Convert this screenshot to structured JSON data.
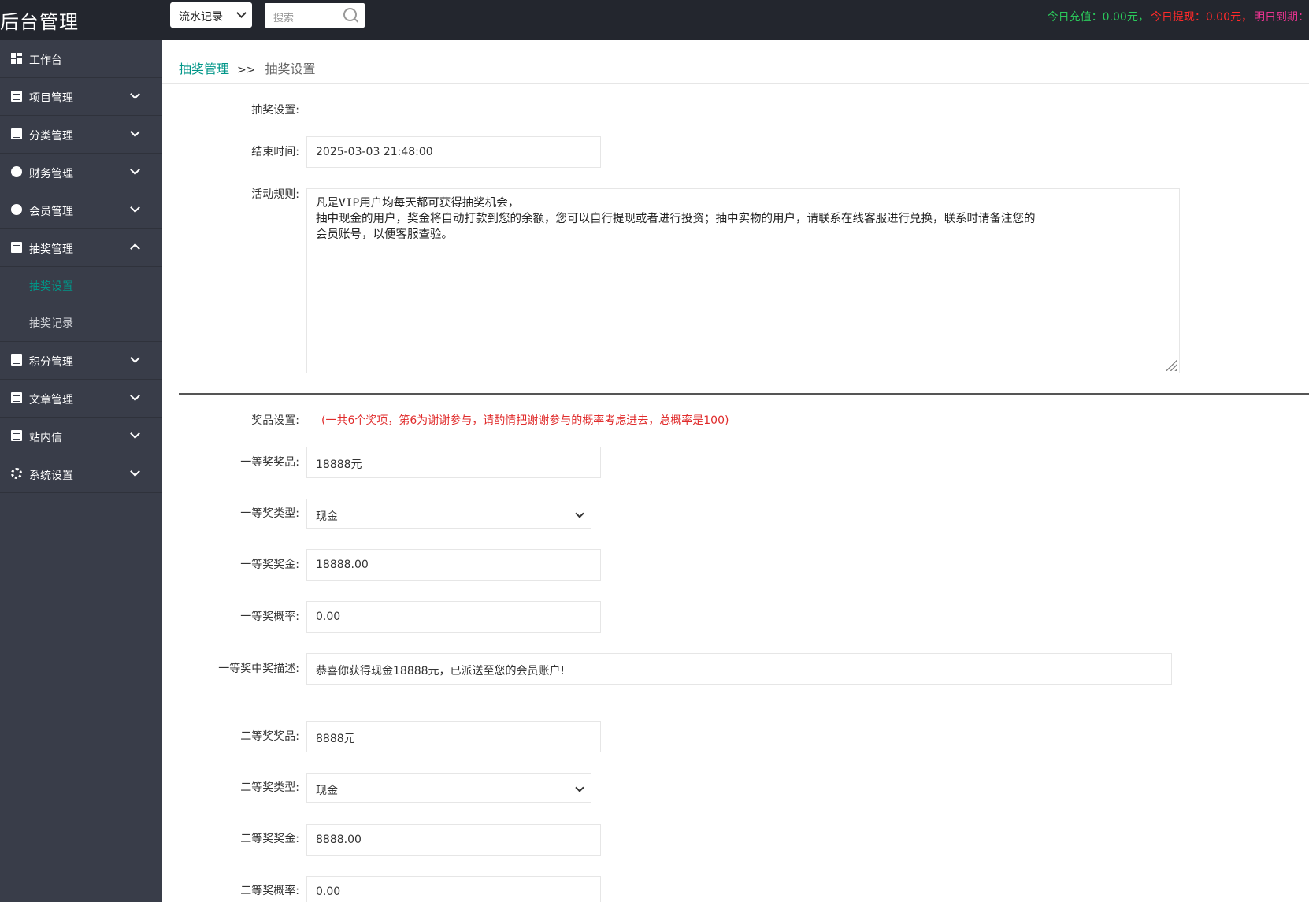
{
  "app": {
    "title": "后台管理"
  },
  "topbar": {
    "select_value": "流水记录",
    "search_placeholder": "搜索",
    "stats": [
      {
        "text": "今日充值：0.00元，",
        "color": "#2bc85b"
      },
      {
        "text": "今日提现：0.00元，",
        "color": "#ff2a2a"
      },
      {
        "text": "明日到期：",
        "color": "#e8338f"
      }
    ]
  },
  "sidebar": {
    "items": [
      {
        "label": "工作台",
        "icon": "dashboard-icon",
        "expandable": false
      },
      {
        "label": "项目管理",
        "icon": "document-icon",
        "expandable": true
      },
      {
        "label": "分类管理",
        "icon": "document-icon",
        "expandable": true
      },
      {
        "label": "财务管理",
        "icon": "yen-icon",
        "expandable": true
      },
      {
        "label": "会员管理",
        "icon": "vip-icon",
        "expandable": true
      },
      {
        "label": "抽奖管理",
        "icon": "document-icon",
        "expandable": true,
        "expanded": true,
        "children": [
          {
            "label": "抽奖设置",
            "active": true
          },
          {
            "label": "抽奖记录",
            "active": false
          }
        ]
      },
      {
        "label": "积分管理",
        "icon": "document-icon",
        "expandable": true
      },
      {
        "label": "文章管理",
        "icon": "document-icon",
        "expandable": true
      },
      {
        "label": "站内信",
        "icon": "document-icon",
        "expandable": true
      },
      {
        "label": "系统设置",
        "icon": "gear-icon",
        "expandable": true
      }
    ]
  },
  "breadcrumb": {
    "parent": "抽奖管理",
    "separator": ">>",
    "current": "抽奖设置"
  },
  "form": {
    "section1_label": "抽奖设置:",
    "end_time_label": "结束时间:",
    "end_time_value": "2025-03-03 21:48:00",
    "rules_label": "活动规则:",
    "rules_lines": [
      "凡是VIP用户均每天都可获得抽奖机会，",
      "抽中现金的用户，奖金将自动打款到您的余额，您可以自行提现或者进行投资；抽中实物的用户，请联系在线客服进行兑换，联系时请备注您的",
      "会员账号，以便客服查验。"
    ],
    "prize_section_label": "奖品设置:",
    "prize_note": "(一共6个奖项，第6为谢谢参与，请酌情把谢谢参与的概率考虑进去，总概率是100)",
    "first": {
      "prize_label": "一等奖奖品:",
      "prize_value": "18888元",
      "type_label": "一等奖类型:",
      "type_value": "现金",
      "amount_label": "一等奖奖金:",
      "amount_value": "18888.00",
      "rate_label": "一等奖概率:",
      "rate_value": "0.00",
      "desc_label": "一等奖中奖描述:",
      "desc_value": "恭喜你获得现金18888元，已派送至您的会员账户!"
    },
    "second": {
      "prize_label": "二等奖奖品:",
      "prize_value": "8888元",
      "type_label": "二等奖类型:",
      "type_value": "现金",
      "amount_label": "二等奖奖金:",
      "amount_value": "8888.00",
      "rate_label": "二等奖概率:",
      "rate_value": "0.00"
    }
  }
}
